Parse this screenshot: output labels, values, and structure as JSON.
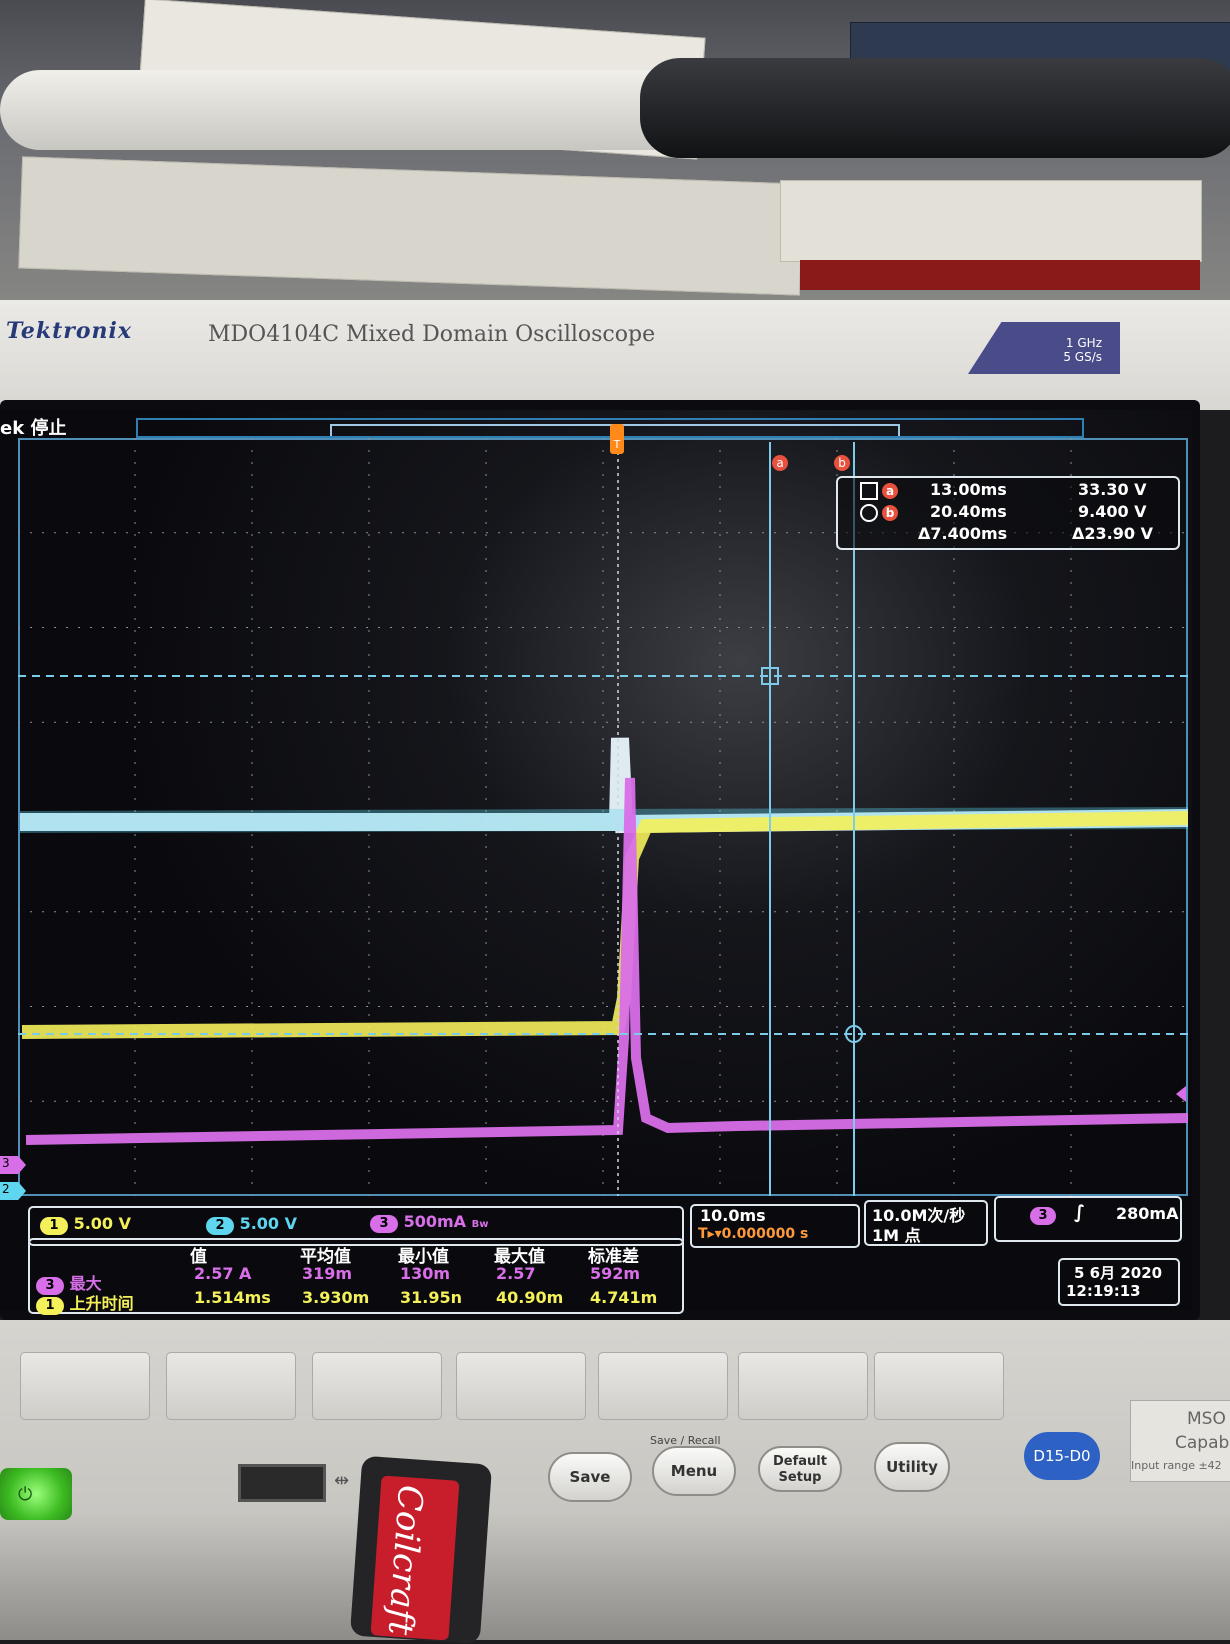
{
  "brand": "Tektronix",
  "model": "MDO4104C  Mixed Domain Oscilloscope",
  "spec": [
    "1 GHz",
    "5 GS/s"
  ],
  "status": "ek 停止",
  "cursor_markers": {
    "a": "a",
    "b": "b",
    "trigger": "T"
  },
  "cursors": {
    "row_a": {
      "time": "13.00ms",
      "value": "33.30 V"
    },
    "row_b": {
      "time": "20.40ms",
      "value": "9.400 V"
    },
    "delta": {
      "time": "Δ7.400ms",
      "value": "Δ23.90 V"
    }
  },
  "channels": [
    {
      "num": "1",
      "scale": "5.00 V",
      "color": "#f4f05a"
    },
    {
      "num": "2",
      "scale": "5.00 V",
      "color": "#5ed6f0"
    },
    {
      "num": "3",
      "scale": "500mA",
      "color": "#d86fe8"
    }
  ],
  "bw_mark": "Bw",
  "timebase": {
    "scale": "10.0ms",
    "delay": "T▸▾0.000000 s"
  },
  "acquisition": {
    "rate": "10.0M次/秒",
    "points": "1M 点"
  },
  "trigger": {
    "channel": "3",
    "slope": "∫",
    "level": "280mA"
  },
  "measurements": {
    "headers": [
      "值",
      "平均值",
      "最小值",
      "最大值",
      "标准差"
    ],
    "rows": [
      {
        "ch": "3",
        "label": "最大",
        "values": [
          "2.57 A",
          "319m",
          "130m",
          "2.57",
          "592m"
        ],
        "color": "#d86fe8"
      },
      {
        "ch": "1",
        "label": "上升时间",
        "values": [
          "1.514ms",
          "3.930m",
          "31.95n",
          "40.90m",
          "4.741m"
        ],
        "color": "#f4f05a"
      }
    ]
  },
  "datetime": {
    "date": "5 6月 2020",
    "time": "12:19:13"
  },
  "ground_markers": [
    "3",
    "2"
  ],
  "buttons": {
    "group_label": "Save / Recall",
    "save": "Save",
    "menu": "Menu",
    "default": [
      "Default",
      "Setup"
    ],
    "utility": "Utility",
    "digital": "D15-D0"
  },
  "side_label": [
    "MSO",
    "Capab",
    "Input range ±42"
  ],
  "stick_text": "Coilcraft",
  "colors": {
    "ch1": "#f4f05a",
    "ch2": "#5ed6f0",
    "ch3": "#d86fe8",
    "grid": "#4f8fb8",
    "cursor": "#7ccbe8"
  }
}
